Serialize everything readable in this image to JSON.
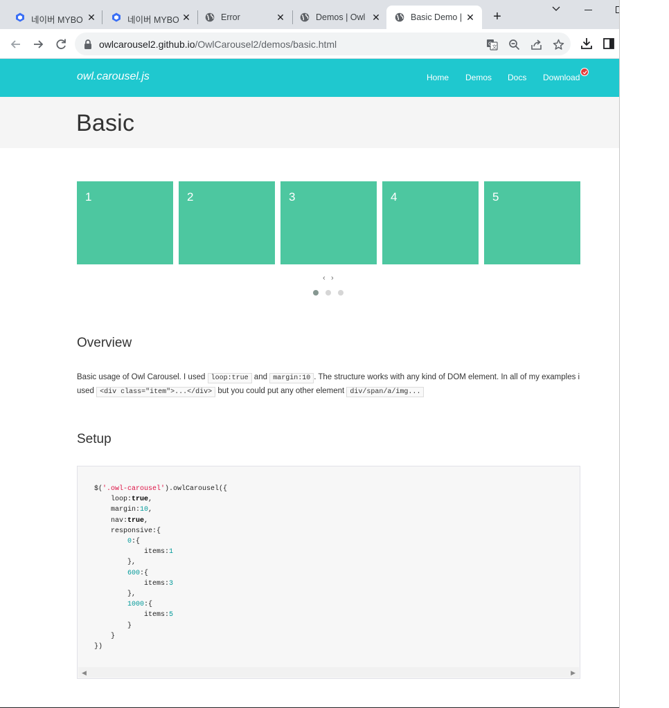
{
  "browser": {
    "tabs": [
      {
        "title": "네이버 MYBO",
        "favicon": "naver-cube-icon"
      },
      {
        "title": "네이버 MYBO",
        "favicon": "naver-cube-icon"
      },
      {
        "title": "Error",
        "favicon": "globe-icon"
      },
      {
        "title": "Demos | Owl",
        "favicon": "globe-icon"
      },
      {
        "title": "Basic Demo |",
        "favicon": "globe-icon",
        "active": true
      }
    ],
    "new_tab": "+",
    "url_host": "owlcarousel2.github.io",
    "url_path": "/OwlCarousel2/demos/basic.html"
  },
  "site": {
    "brand": "owl.carousel.js",
    "nav": [
      "Home",
      "Demos",
      "Docs",
      "Download"
    ],
    "accent": "#1fc8cf",
    "item_color": "#4dc7a0"
  },
  "page": {
    "title": "Basic",
    "carousel_items": [
      "1",
      "2",
      "3",
      "4",
      "5"
    ],
    "prev": "‹",
    "next": "›",
    "overview_heading": "Overview",
    "overview": {
      "t1": "Basic usage of Owl Carousel. I used",
      "c1": "loop:true",
      "t2": "and",
      "c2": "margin:10",
      "t3": ". The structure works with any kind of DOM element. In all of my examples i",
      "t4": "used",
      "c3": "<div class=\"item\">...</div>",
      "t5": "but you could put any other element",
      "c4": "div/span/a/img..."
    },
    "setup_heading": "Setup"
  }
}
